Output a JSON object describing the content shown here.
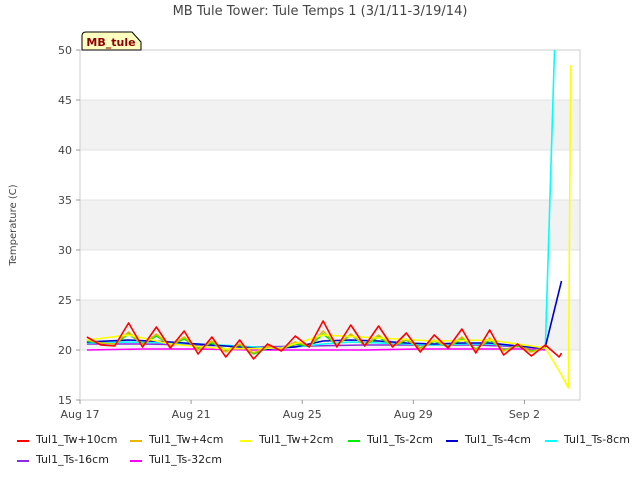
{
  "chart_data": {
    "type": "line",
    "title": "MB Tule Tower: Tule Temps 1 (3/1/11-3/19/14)",
    "site_badge": "MB_tule",
    "ylabel": "Temperature (C)",
    "xlabel": "",
    "ylim": [
      15,
      50
    ],
    "xlim": [
      "2011-08-17",
      "2011-09-04"
    ],
    "y_ticks": [
      15,
      20,
      25,
      30,
      35,
      40,
      45,
      50
    ],
    "x_ticks": [
      {
        "label": "Aug 17",
        "date": "2011-08-17"
      },
      {
        "label": "Aug 21",
        "date": "2011-08-21"
      },
      {
        "label": "Aug 25",
        "date": "2011-08-25"
      },
      {
        "label": "Aug 29",
        "date": "2011-08-29"
      },
      {
        "label": "Sep 2",
        "date": "2011-09-02"
      }
    ],
    "grid": true,
    "legend_position": "bottom",
    "series": [
      {
        "name": "Tul1_Tw+10cm",
        "color": "#ff0000",
        "points": [
          [
            "2011-08-17 06:00",
            21.3
          ],
          [
            "2011-08-17 18:00",
            20.5
          ],
          [
            "2011-08-18 06:00",
            20.4
          ],
          [
            "2011-08-18 18:00",
            22.7
          ],
          [
            "2011-08-19 06:00",
            20.3
          ],
          [
            "2011-08-19 18:00",
            22.3
          ],
          [
            "2011-08-20 06:00",
            20.2
          ],
          [
            "2011-08-20 18:00",
            21.9
          ],
          [
            "2011-08-21 06:00",
            19.6
          ],
          [
            "2011-08-21 18:00",
            21.3
          ],
          [
            "2011-08-22 06:00",
            19.3
          ],
          [
            "2011-08-22 18:00",
            21.0
          ],
          [
            "2011-08-23 06:00",
            19.1
          ],
          [
            "2011-08-23 18:00",
            20.6
          ],
          [
            "2011-08-24 06:00",
            19.9
          ],
          [
            "2011-08-24 18:00",
            21.4
          ],
          [
            "2011-08-25 06:00",
            20.3
          ],
          [
            "2011-08-25 18:00",
            22.9
          ],
          [
            "2011-08-26 06:00",
            20.3
          ],
          [
            "2011-08-26 18:00",
            22.5
          ],
          [
            "2011-08-27 06:00",
            20.4
          ],
          [
            "2011-08-27 18:00",
            22.4
          ],
          [
            "2011-08-28 06:00",
            20.3
          ],
          [
            "2011-08-28 18:00",
            21.7
          ],
          [
            "2011-08-29 06:00",
            19.8
          ],
          [
            "2011-08-29 18:00",
            21.5
          ],
          [
            "2011-08-30 06:00",
            20.2
          ],
          [
            "2011-08-30 18:00",
            22.1
          ],
          [
            "2011-08-31 06:00",
            19.7
          ],
          [
            "2011-08-31 18:00",
            22.0
          ],
          [
            "2011-09-01 06:00",
            19.5
          ],
          [
            "2011-09-01 18:00",
            20.6
          ],
          [
            "2011-09-02 06:00",
            19.4
          ],
          [
            "2011-09-02 18:00",
            20.5
          ],
          [
            "2011-09-03 06:00",
            19.3
          ],
          [
            "2011-09-03 08:00",
            19.7
          ]
        ]
      },
      {
        "name": "Tul1_Tw+4cm",
        "color": "#e6b800",
        "points": [
          [
            "2011-08-17 06:00",
            21.0
          ],
          [
            "2011-08-17 18:00",
            20.7
          ],
          [
            "2011-08-18 06:00",
            20.6
          ],
          [
            "2011-08-18 18:00",
            21.8
          ],
          [
            "2011-08-19 06:00",
            20.5
          ],
          [
            "2011-08-19 18:00",
            21.6
          ],
          [
            "2011-08-20 06:00",
            20.4
          ],
          [
            "2011-08-20 18:00",
            21.3
          ],
          [
            "2011-08-21 06:00",
            20.0
          ],
          [
            "2011-08-21 18:00",
            20.9
          ],
          [
            "2011-08-22 06:00",
            19.8
          ],
          [
            "2011-08-22 18:00",
            20.6
          ],
          [
            "2011-08-23 06:00",
            19.7
          ],
          [
            "2011-08-23 18:00",
            20.4
          ],
          [
            "2011-08-24 06:00",
            20.1
          ],
          [
            "2011-08-24 18:00",
            20.8
          ],
          [
            "2011-08-25 06:00",
            20.4
          ],
          [
            "2011-08-25 18:00",
            21.9
          ],
          [
            "2011-08-26 06:00",
            20.5
          ],
          [
            "2011-08-26 18:00",
            21.6
          ],
          [
            "2011-08-27 06:00",
            20.5
          ],
          [
            "2011-08-27 18:00",
            21.5
          ],
          [
            "2011-08-28 06:00",
            20.4
          ],
          [
            "2011-08-28 18:00",
            21.1
          ],
          [
            "2011-08-29 06:00",
            20.1
          ],
          [
            "2011-08-29 18:00",
            21.0
          ],
          [
            "2011-08-30 06:00",
            20.3
          ],
          [
            "2011-08-30 18:00",
            21.3
          ],
          [
            "2011-08-31 06:00",
            20.0
          ],
          [
            "2011-08-31 18:00",
            21.2
          ],
          [
            "2011-09-01 06:00",
            19.9
          ],
          [
            "2011-09-01 18:00",
            20.5
          ],
          [
            "2011-09-02 06:00",
            19.8
          ],
          [
            "2011-09-02 18:00",
            20.3
          ]
        ]
      },
      {
        "name": "Tul1_Tw+2cm",
        "color": "#ffff00",
        "points": [
          [
            "2011-08-17 06:00",
            21.0
          ],
          [
            "2011-08-18 18:00",
            21.5
          ],
          [
            "2011-08-20 06:00",
            20.6
          ],
          [
            "2011-08-22 06:00",
            20.1
          ],
          [
            "2011-08-24 06:00",
            20.2
          ],
          [
            "2011-08-25 18:00",
            21.5
          ],
          [
            "2011-08-27 18:00",
            21.2
          ],
          [
            "2011-08-29 18:00",
            20.9
          ],
          [
            "2011-08-31 18:00",
            21.0
          ],
          [
            "2011-09-02 18:00",
            20.2
          ],
          [
            "2011-09-03 08:00",
            17.5
          ],
          [
            "2011-09-03 14:00",
            16.2
          ],
          [
            "2011-09-03 16:00",
            48.5
          ]
        ]
      },
      {
        "name": "Tul1_Ts-2cm",
        "color": "#00ee00",
        "points": [
          [
            "2011-08-17 06:00",
            20.9
          ],
          [
            "2011-08-17 18:00",
            20.7
          ],
          [
            "2011-08-18 06:00",
            20.6
          ],
          [
            "2011-08-18 18:00",
            21.6
          ],
          [
            "2011-08-19 06:00",
            20.6
          ],
          [
            "2011-08-19 18:00",
            21.4
          ],
          [
            "2011-08-20 06:00",
            20.5
          ],
          [
            "2011-08-20 18:00",
            21.1
          ],
          [
            "2011-08-21 06:00",
            20.2
          ],
          [
            "2011-08-21 18:00",
            20.7
          ],
          [
            "2011-08-22 06:00",
            20.0
          ],
          [
            "2011-08-22 18:00",
            20.5
          ],
          [
            "2011-08-23 06:00",
            19.6
          ],
          [
            "2011-08-23 18:00",
            20.2
          ],
          [
            "2011-08-24 06:00",
            20.1
          ],
          [
            "2011-08-24 18:00",
            20.6
          ],
          [
            "2011-08-25 06:00",
            20.4
          ],
          [
            "2011-08-25 18:00",
            21.6
          ],
          [
            "2011-08-26 06:00",
            20.5
          ],
          [
            "2011-08-26 18:00",
            21.5
          ],
          [
            "2011-08-27 06:00",
            20.5
          ],
          [
            "2011-08-27 18:00",
            21.3
          ],
          [
            "2011-08-28 06:00",
            20.4
          ],
          [
            "2011-08-28 18:00",
            21.0
          ],
          [
            "2011-08-29 06:00",
            20.2
          ],
          [
            "2011-08-29 18:00",
            20.9
          ],
          [
            "2011-08-30 06:00",
            20.3
          ],
          [
            "2011-08-30 18:00",
            21.1
          ],
          [
            "2011-08-31 06:00",
            20.1
          ],
          [
            "2011-08-31 18:00",
            21.0
          ],
          [
            "2011-09-01 06:00",
            20.0
          ],
          [
            "2011-09-01 18:00",
            20.4
          ],
          [
            "2011-09-02 06:00",
            19.9
          ],
          [
            "2011-09-02 18:00",
            20.2
          ]
        ]
      },
      {
        "name": "Tul1_Ts-4cm",
        "color": "#0000cc",
        "points": [
          [
            "2011-08-17 06:00",
            20.8
          ],
          [
            "2011-08-18 18:00",
            21.0
          ],
          [
            "2011-08-20 06:00",
            20.8
          ],
          [
            "2011-08-21 06:00",
            20.6
          ],
          [
            "2011-08-22 18:00",
            20.3
          ],
          [
            "2011-08-23 18:00",
            20.1
          ],
          [
            "2011-08-24 18:00",
            20.3
          ],
          [
            "2011-08-25 18:00",
            20.9
          ],
          [
            "2011-08-26 18:00",
            21.0
          ],
          [
            "2011-08-27 18:00",
            20.9
          ],
          [
            "2011-08-28 18:00",
            20.7
          ],
          [
            "2011-08-29 18:00",
            20.6
          ],
          [
            "2011-08-30 18:00",
            20.7
          ],
          [
            "2011-08-31 18:00",
            20.7
          ],
          [
            "2011-09-01 18:00",
            20.4
          ],
          [
            "2011-09-02 12:00",
            20.2
          ],
          [
            "2011-09-02 18:00",
            20.3
          ],
          [
            "2011-09-03 08:00",
            26.9
          ]
        ]
      },
      {
        "name": "Tul1_Ts-8cm",
        "color": "#00ffff",
        "points": [
          [
            "2011-08-17 06:00",
            20.7
          ],
          [
            "2011-08-18 18:00",
            20.8
          ],
          [
            "2011-08-20 06:00",
            20.7
          ],
          [
            "2011-08-21 06:00",
            20.6
          ],
          [
            "2011-08-22 18:00",
            20.4
          ],
          [
            "2011-08-23 18:00",
            20.2
          ],
          [
            "2011-08-24 18:00",
            20.3
          ],
          [
            "2011-08-25 18:00",
            20.6
          ],
          [
            "2011-08-26 18:00",
            20.8
          ],
          [
            "2011-08-27 18:00",
            20.7
          ],
          [
            "2011-08-28 18:00",
            20.6
          ],
          [
            "2011-08-29 18:00",
            20.5
          ],
          [
            "2011-08-30 18:00",
            20.6
          ],
          [
            "2011-08-31 18:00",
            20.6
          ],
          [
            "2011-09-01 18:00",
            20.4
          ],
          [
            "2011-09-02 12:00",
            20.2
          ],
          [
            "2011-09-02 18:00",
            20.2
          ],
          [
            "2011-09-02 22:00",
            35.0
          ],
          [
            "2011-09-03 02:00",
            50.0
          ]
        ]
      },
      {
        "name": "Tul1_Ts-16cm",
        "color": "#8a2be2",
        "points": [
          [
            "2011-08-17 06:00",
            20.6
          ],
          [
            "2011-08-19 06:00",
            20.6
          ],
          [
            "2011-08-21 06:00",
            20.5
          ],
          [
            "2011-08-23 06:00",
            20.3
          ],
          [
            "2011-08-25 06:00",
            20.4
          ],
          [
            "2011-08-27 06:00",
            20.5
          ],
          [
            "2011-08-29 06:00",
            20.5
          ],
          [
            "2011-08-31 06:00",
            20.5
          ],
          [
            "2011-09-02 06:00",
            20.3
          ],
          [
            "2011-09-02 18:00",
            20.1
          ]
        ]
      },
      {
        "name": "Tul1_Ts-32cm",
        "color": "#ff00ff",
        "points": [
          [
            "2011-08-17 06:00",
            20.0
          ],
          [
            "2011-08-19 06:00",
            20.1
          ],
          [
            "2011-08-21 06:00",
            20.1
          ],
          [
            "2011-08-23 06:00",
            20.0
          ],
          [
            "2011-08-25 06:00",
            20.0
          ],
          [
            "2011-08-27 06:00",
            20.0
          ],
          [
            "2011-08-29 06:00",
            20.1
          ],
          [
            "2011-08-31 06:00",
            20.1
          ],
          [
            "2011-09-02 06:00",
            20.1
          ],
          [
            "2011-09-02 18:00",
            20.0
          ]
        ]
      }
    ]
  }
}
